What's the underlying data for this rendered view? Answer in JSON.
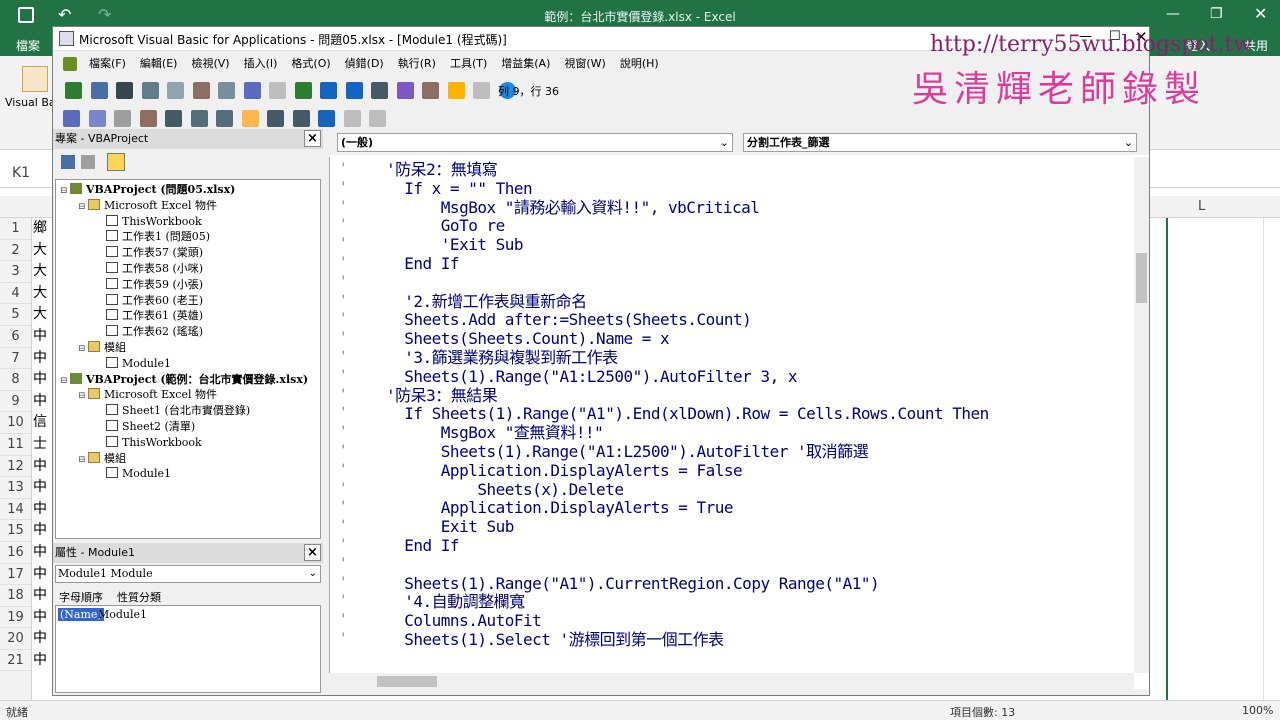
{
  "excel": {
    "title": "範例：台北市實價登錄.xlsx - Excel",
    "file_tab": "檔案",
    "sign_in": "登入",
    "share": "共用",
    "ribbon_group": "Visual Ba",
    "name_box": "K1",
    "col_L": "L",
    "row_numbers": [
      "1",
      "2",
      "3",
      "4",
      "5",
      "6",
      "7",
      "8",
      "9",
      "10",
      "11",
      "12",
      "13",
      "14",
      "15",
      "16",
      "17",
      "18",
      "19",
      "20",
      "21"
    ],
    "cell_chars": [
      "鄉",
      "大",
      "大",
      "大",
      "大",
      "中",
      "中",
      "中",
      "中",
      "信",
      "士",
      "中",
      "中",
      "中",
      "中",
      "中",
      "中",
      "中",
      "中",
      "中",
      "中"
    ],
    "status_ready": "就緒",
    "status_count": "項目個數: 13",
    "zoom": "100%"
  },
  "vbe": {
    "title": "Microsoft Visual Basic for Applications - 問題05.xlsx - [Module1 (程式碼)]",
    "menu": [
      "檔案(F)",
      "編輯(E)",
      "檢視(V)",
      "插入(I)",
      "格式(O)",
      "偵錯(D)",
      "執行(R)",
      "工具(T)",
      "增益集(A)",
      "視窗(W)",
      "說明(H)"
    ],
    "position": "列 9，行 36",
    "project_title": "專案 - VBAProject",
    "tree": [
      {
        "label": "VBAProject (問題05.xlsx)",
        "level": 0,
        "bold": true
      },
      {
        "label": "Microsoft Excel 物件",
        "level": 1
      },
      {
        "label": "ThisWorkbook",
        "level": 2
      },
      {
        "label": "工作表1 (問題05)",
        "level": 2
      },
      {
        "label": "工作表57 (棠頭)",
        "level": 2
      },
      {
        "label": "工作表58 (小咪)",
        "level": 2
      },
      {
        "label": "工作表59 (小張)",
        "level": 2
      },
      {
        "label": "工作表60 (老王)",
        "level": 2
      },
      {
        "label": "工作表61 (英雄)",
        "level": 2
      },
      {
        "label": "工作表62 (瑤瑤)",
        "level": 2
      },
      {
        "label": "模組",
        "level": 1
      },
      {
        "label": "Module1",
        "level": 2
      },
      {
        "label": "VBAProject (範例：台北市實價登錄.xlsx)",
        "level": 0,
        "bold": true
      },
      {
        "label": "Microsoft Excel 物件",
        "level": 1
      },
      {
        "label": "Sheet1 (台北市實價登錄)",
        "level": 2
      },
      {
        "label": "Sheet2 (清單)",
        "level": 2
      },
      {
        "label": "ThisWorkbook",
        "level": 2
      },
      {
        "label": "模組",
        "level": 1
      },
      {
        "label": "Module1",
        "level": 2
      }
    ],
    "props_title": "屬性 - Module1",
    "props_object": "Module1 Module",
    "props_tab_alpha": "字母順序",
    "props_tab_cat": "性質分類",
    "props_name_key": "(Name)",
    "props_name_val": "Module1",
    "object_combo": "(一般)",
    "proc_combo": "分割工作表_篩選",
    "code_lines": [
      "'防呆2：無填寫",
      "  If x = \"\" Then",
      "      MsgBox \"請務必輸入資料!!\", vbCritical",
      "      GoTo re",
      "      'Exit Sub",
      "  End If",
      "",
      "  '2.新增工作表與重新命名",
      "  Sheets.Add after:=Sheets(Sheets.Count)",
      "  Sheets(Sheets.Count).Name = x",
      "  '3.篩選業務與複製到新工作表",
      "  Sheets(1).Range(\"A1:L2500\").AutoFilter 3, x",
      "'防呆3：無結果",
      "  If Sheets(1).Range(\"A1\").End(xlDown).Row = Cells.Rows.Count Then",
      "      MsgBox \"查無資料!!\"",
      "      Sheets(1).Range(\"A1:L2500\").AutoFilter '取消篩選",
      "      Application.DisplayAlerts = False",
      "          Sheets(x).Delete",
      "      Application.DisplayAlerts = True",
      "      Exit Sub",
      "  End If",
      "",
      "  Sheets(1).Range(\"A1\").CurrentRegion.Copy Range(\"A1\")",
      "  '4.自動調整欄寬",
      "  Columns.AutoFit",
      "  Sheets(1).Select '游標回到第一個工作表"
    ]
  },
  "watermark": {
    "url": "http://terry55wu.blogspot.tw",
    "name": "吳清輝老師錄製"
  }
}
